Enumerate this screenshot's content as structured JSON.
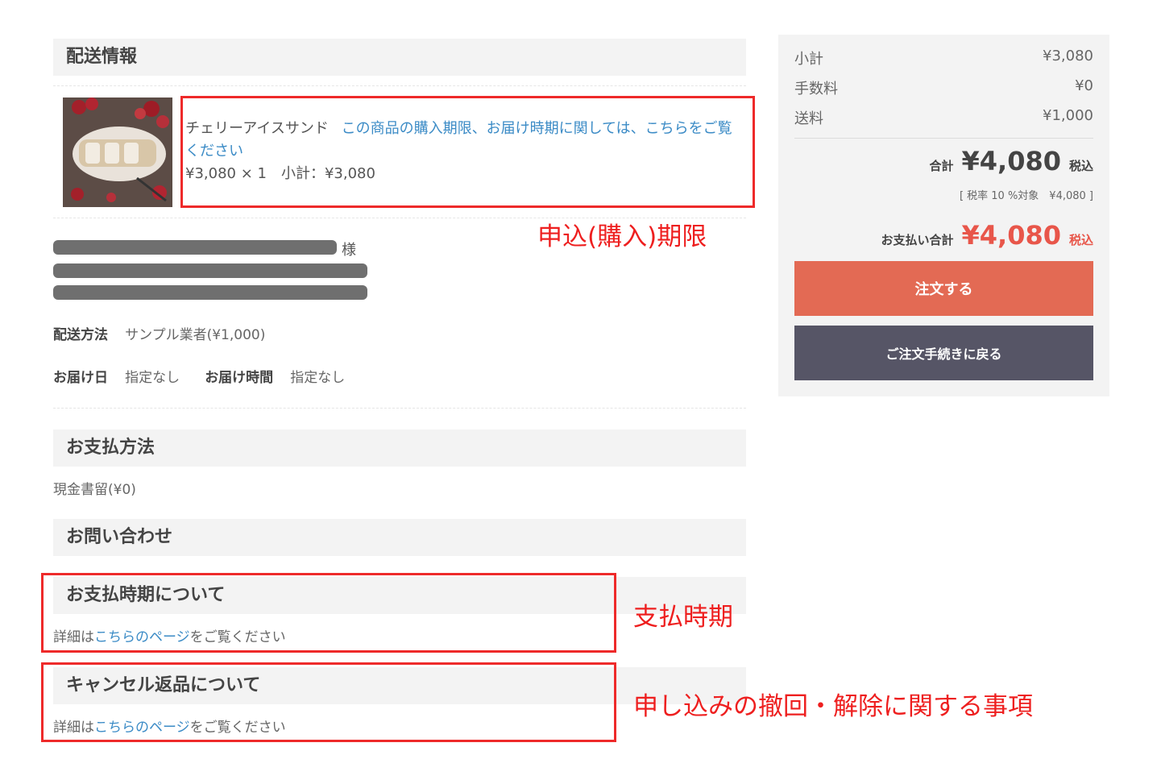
{
  "delivery": {
    "header": "配送情報",
    "product_name": "チェリーアイスサンド",
    "product_link": "この商品の購入期限、お届け時期に関しては、こちらをご覧ください",
    "product_price_line": "¥3,080 × 1　小計：¥3,080",
    "recipient_suffix": "様",
    "method_label": "配送方法",
    "method_value": "サンプル業者(¥1,000)",
    "date_label": "お届け日",
    "date_value": "指定なし",
    "time_label": "お届け時間",
    "time_value": "指定なし"
  },
  "payment": {
    "header": "お支払方法",
    "value": "現金書留(¥0)"
  },
  "contact": {
    "header": "お問い合わせ"
  },
  "payment_timing": {
    "header": "お支払時期について",
    "text_before": "詳細は",
    "link": "こちらのページ",
    "text_after": "をご覧ください"
  },
  "cancel_return": {
    "header": "キャンセル返品について",
    "text_before": "詳細は",
    "link": "こちらのページ",
    "text_after": "をご覧ください"
  },
  "annotations": {
    "deadline": "申込(購入)期限",
    "payment_timing": "支払時期",
    "withdrawal": "申し込みの撤回・解除に関する事項"
  },
  "summary": {
    "subtotal_label": "小計",
    "subtotal_value": "¥3,080",
    "fee_label": "手数料",
    "fee_value": "¥0",
    "shipping_label": "送料",
    "shipping_value": "¥1,000",
    "total_label": "合計",
    "total_value": "¥4,080",
    "tax_incl": "税込",
    "tax_note": "[ 税率 10 %対象　¥4,080 ]",
    "pay_total_label": "お支払い合計",
    "pay_total_value": "¥4,080",
    "pay_tax_incl": "税込",
    "order_button": "注文する",
    "back_button": "ご注文手続きに戻る"
  },
  "colors": {
    "accent_red": "#ee2a2a",
    "order_button": "#e36a54",
    "back_button": "#565566",
    "total_red": "#e8564a",
    "link_blue": "#3b8bc6"
  }
}
